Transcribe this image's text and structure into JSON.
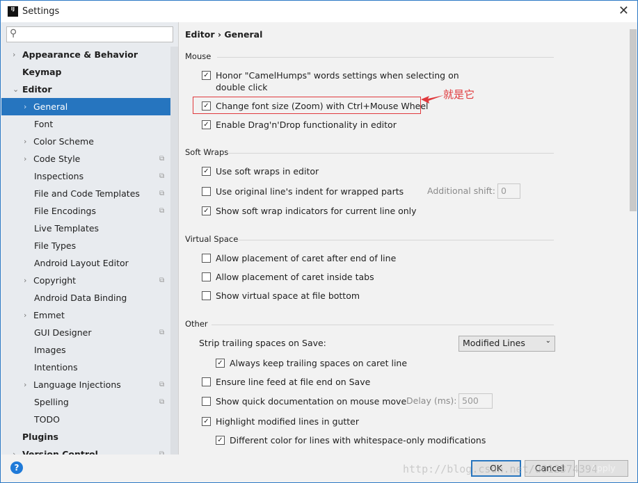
{
  "window": {
    "title": "Settings",
    "logo": "IJ",
    "close": "✕"
  },
  "sidebar": {
    "search_placeholder": "",
    "items": [
      {
        "label": "Appearance & Behavior",
        "level": 0,
        "arrow": "›",
        "bold": true
      },
      {
        "label": "Keymap",
        "level": 0,
        "bold": true
      },
      {
        "label": "Editor",
        "level": 0,
        "arrow": "⌄",
        "bold": true
      },
      {
        "label": "General",
        "level": 1,
        "arrow": "›",
        "selected": true
      },
      {
        "label": "Font",
        "level": 1
      },
      {
        "label": "Color Scheme",
        "level": 1,
        "arrow": "›"
      },
      {
        "label": "Code Style",
        "level": 1,
        "arrow": "›",
        "copy": true
      },
      {
        "label": "Inspections",
        "level": 1,
        "copy": true
      },
      {
        "label": "File and Code Templates",
        "level": 1,
        "copy": true
      },
      {
        "label": "File Encodings",
        "level": 1,
        "copy": true
      },
      {
        "label": "Live Templates",
        "level": 1
      },
      {
        "label": "File Types",
        "level": 1
      },
      {
        "label": "Android Layout Editor",
        "level": 1
      },
      {
        "label": "Copyright",
        "level": 1,
        "arrow": "›",
        "copy": true
      },
      {
        "label": "Android Data Binding",
        "level": 1
      },
      {
        "label": "Emmet",
        "level": 1,
        "arrow": "›"
      },
      {
        "label": "GUI Designer",
        "level": 1,
        "copy": true
      },
      {
        "label": "Images",
        "level": 1
      },
      {
        "label": "Intentions",
        "level": 1
      },
      {
        "label": "Language Injections",
        "level": 1,
        "arrow": "›",
        "copy": true
      },
      {
        "label": "Spelling",
        "level": 1,
        "copy": true
      },
      {
        "label": "TODO",
        "level": 1
      },
      {
        "label": "Plugins",
        "level": 0,
        "bold": true
      },
      {
        "label": "Version Control",
        "level": 0,
        "arrow": "›",
        "bold": true,
        "copy": true
      }
    ]
  },
  "main": {
    "breadcrumb": "Editor › General",
    "sections": {
      "mouse": "Mouse",
      "soft_wraps": "Soft Wraps",
      "virtual_space": "Virtual Space",
      "other": "Other"
    },
    "options": [
      {
        "label": "Honor \"CamelHumps\" words settings when selecting on",
        "label2": "double click",
        "checked": true
      },
      {
        "label": "Change font size (Zoom) with Ctrl+Mouse Wheel",
        "checked": true
      },
      {
        "label": "Enable Drag'n'Drop functionality in editor",
        "checked": true
      },
      {
        "label": "Use soft wraps in editor",
        "checked": true
      },
      {
        "label": "Use original line's indent for wrapped parts",
        "checked": false
      },
      {
        "label": "Show soft wrap indicators for current line only",
        "checked": true
      },
      {
        "label": "Allow placement of caret after end of line",
        "checked": false
      },
      {
        "label": "Allow placement of caret inside tabs",
        "checked": false
      },
      {
        "label": "Show virtual space at file bottom",
        "checked": false
      },
      {
        "label": "Always keep trailing spaces on caret line",
        "checked": true
      },
      {
        "label": "Ensure line feed at file end on Save",
        "checked": false
      },
      {
        "label": "Show quick documentation on mouse move",
        "checked": false
      },
      {
        "label": "Highlight modified lines in gutter",
        "checked": true
      },
      {
        "label": "Different color for lines with whitespace-only modifications",
        "checked": true
      }
    ],
    "additional_shift": {
      "label": "Additional shift:",
      "value": "0"
    },
    "strip_trailing": {
      "label": "Strip trailing spaces on Save:",
      "value": "Modified Lines"
    },
    "delay": {
      "label": "Delay (ms):",
      "value": "500"
    },
    "annotation": "就是它",
    "highlight_color": "#e0393c"
  },
  "footer": {
    "help": "?",
    "ok": "OK",
    "cancel": "Cancel",
    "apply": "Apply",
    "watermark": "http://blog.csdn.net/u012374394"
  }
}
